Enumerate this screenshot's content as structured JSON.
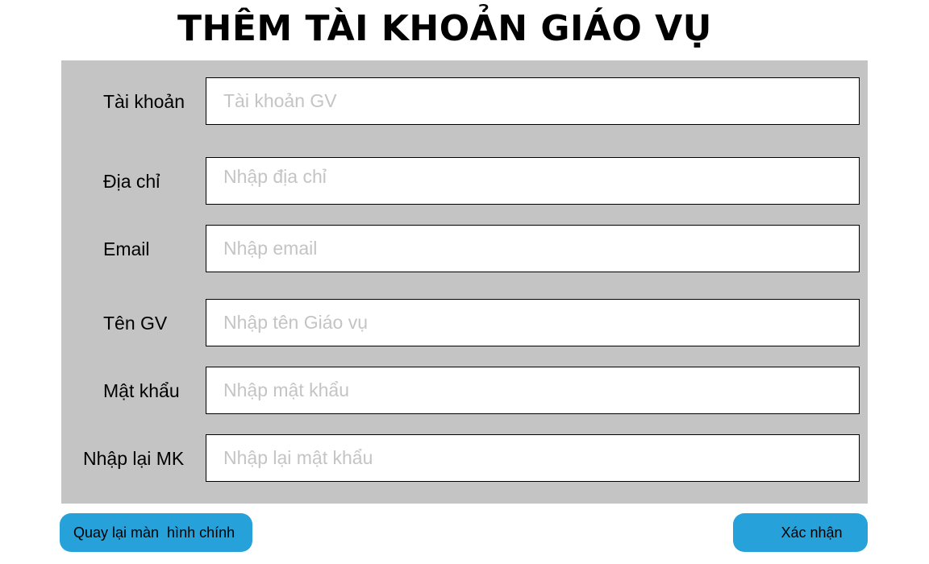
{
  "page": {
    "title": "THÊM TÀI KHOẢN GIÁO VỤ"
  },
  "form": {
    "fields": [
      {
        "label": "Tài khoản",
        "value": "",
        "placeholder": "Tài khoản GV"
      },
      {
        "label": "Địa chỉ",
        "value": "",
        "placeholder": "Nhập địa chỉ"
      },
      {
        "label": "Email",
        "value": "",
        "placeholder": "Nhập email"
      },
      {
        "label": "Tên GV",
        "value": "",
        "placeholder": "Nhập tên Giáo vụ"
      },
      {
        "label": "Mật khẩu",
        "value": "",
        "placeholder": "Nhập mật khẩu"
      },
      {
        "label": "Nhập lại MK",
        "value": "",
        "placeholder": "Nhập lại mật khẩu"
      }
    ]
  },
  "actions": {
    "back_label": "Quay lại màn  hình chính",
    "confirm_label": "Xác nhận"
  },
  "colors": {
    "panel": "#c4c4c4",
    "button": "#26a1d9",
    "placeholder": "#c4c4c4"
  }
}
